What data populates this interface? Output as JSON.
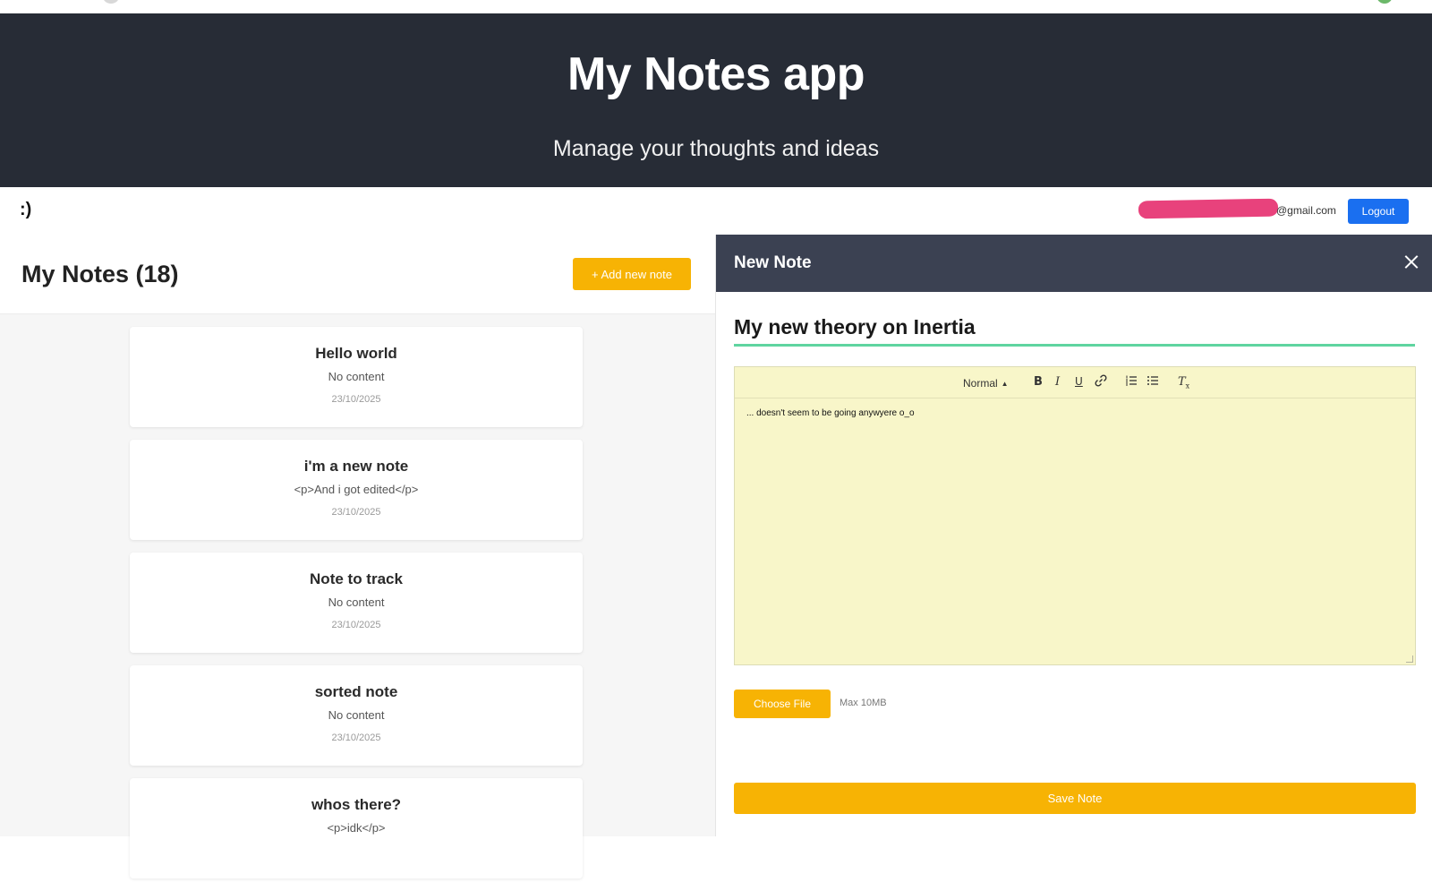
{
  "hero": {
    "title": "My Notes app",
    "subtitle": "Manage your thoughts and ideas"
  },
  "userbar": {
    "brand": ":)",
    "email_suffix": "@gmail.com",
    "logout_label": "Logout"
  },
  "notes_panel": {
    "heading": "My Notes (18)",
    "add_label": "+ Add new note",
    "notes": [
      {
        "title": "Hello world",
        "content": "No content",
        "date": "23/10/2025"
      },
      {
        "title": "i'm a new note",
        "content": "<p>And i got edited</p>",
        "date": "23/10/2025"
      },
      {
        "title": "Note to track",
        "content": "No content",
        "date": "23/10/2025"
      },
      {
        "title": "sorted note",
        "content": "No content",
        "date": "23/10/2025"
      },
      {
        "title": "whos there?",
        "content": "<p>idk</p>",
        "date": ""
      }
    ]
  },
  "editor": {
    "header": "New Note",
    "title_value": "My new theory on Inertia",
    "toolbar": {
      "heading_select": "Normal",
      "icons": [
        "bold-icon",
        "italic-icon",
        "underline-icon",
        "link-icon",
        "ordered-list-icon",
        "bullet-list-icon",
        "clear-format-icon"
      ]
    },
    "body_text": "... doesn't seem to be going anywyere o_o",
    "file_button": "Choose File",
    "file_hint": "Max 10MB",
    "save_label": "Save Note"
  },
  "colors": {
    "hero_bg": "#272c36",
    "editor_header_bg": "#3b4152",
    "accent_yellow": "#f7b304",
    "logout_blue": "#1a6ff0",
    "title_underline": "#5fd4a0",
    "editor_bg": "#f8f6c9",
    "email_redaction": "#e8427c"
  }
}
